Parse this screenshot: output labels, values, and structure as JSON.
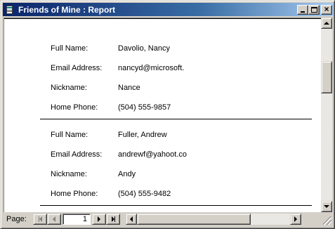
{
  "window": {
    "title": "Friends of Mine : Report"
  },
  "report": {
    "records": [
      {
        "full_name_label": "Full Name:",
        "full_name": "Davolio, Nancy",
        "email_label": "Email Address:",
        "email": "nancyd@microsoft.",
        "nickname_label": "Nickname:",
        "nickname": "Nance",
        "phone_label": "Home Phone:",
        "phone": "(504) 555-9857"
      },
      {
        "full_name_label": "Full Name:",
        "full_name": "Fuller, Andrew",
        "email_label": "Email Address:",
        "email": "andrewf@yahoot.co",
        "nickname_label": "Nickname:",
        "nickname": "Andy",
        "phone_label": "Home Phone:",
        "phone": "(504) 555-9482"
      }
    ]
  },
  "navigation": {
    "page_label": "Page:",
    "page_number": "1"
  }
}
